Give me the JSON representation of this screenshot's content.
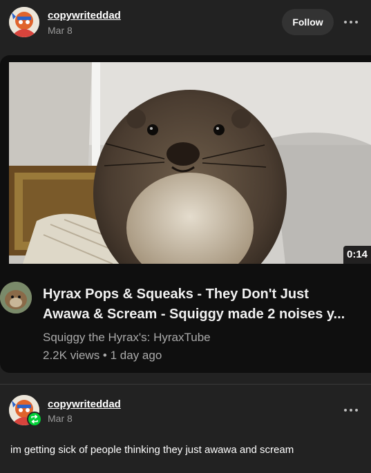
{
  "original_post": {
    "username": "copywriteddad",
    "date": "Mar 8",
    "follow_label": "Follow",
    "more_icon": "ellipsis-icon"
  },
  "video": {
    "duration": "0:14",
    "title_line1": "Hyrax Pops & Squeaks - They Don't Just",
    "title_line2": "Awawa & Scream - Squiggy made 2 noises y...",
    "channel": "Squiggy the Hyrax's: HyraxTube",
    "stats": "2.2K views • 1 day ago"
  },
  "reblog": {
    "username": "copywriteddad",
    "date": "Mar 8",
    "badge_icon": "reblog-icon",
    "more_icon": "ellipsis-icon",
    "body": "im getting sick of people thinking they just awawa and scream"
  },
  "colors": {
    "background": "#222222",
    "video_card": "#0f0f0f",
    "reblog_green": "#00cf35",
    "muted_text": "#9a9a9a"
  }
}
